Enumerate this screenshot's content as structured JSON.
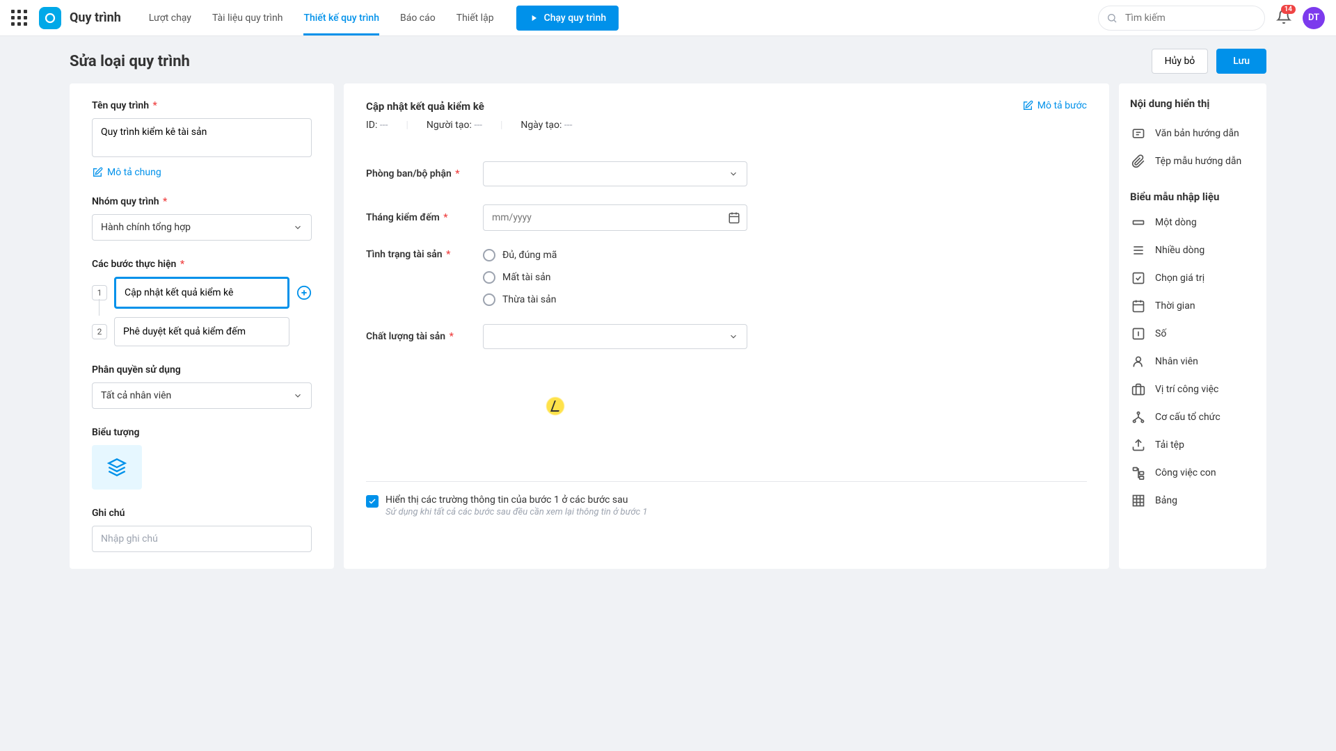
{
  "app": {
    "title": "Quy trình",
    "avatar": "DT",
    "notif_count": "14"
  },
  "nav": {
    "tabs": [
      "Lượt chạy",
      "Tài liệu quy trình",
      "Thiết kế quy trình",
      "Báo cáo",
      "Thiết lập"
    ],
    "active_index": 2,
    "run_label": "Chạy quy trình"
  },
  "search": {
    "placeholder": "Tìm kiếm"
  },
  "page": {
    "title": "Sửa loại quy trình",
    "cancel": "Hủy bỏ",
    "save": "Lưu"
  },
  "left": {
    "name_label": "Tên quy trình",
    "name_value": "Quy trình kiểm kê tài sản",
    "desc_link": "Mô tả chung",
    "group_label": "Nhóm quy trình",
    "group_value": "Hành chính tổng hợp",
    "steps_label": "Các bước thực hiện",
    "steps": [
      {
        "num": "1",
        "value": "Cập nhật kết quả kiểm kê",
        "active": true
      },
      {
        "num": "2",
        "value": "Phê duyệt kết quả kiểm đếm",
        "active": false
      }
    ],
    "perm_label": "Phân quyền sử dụng",
    "perm_value": "Tất cả nhân viên",
    "icon_label": "Biểu tượng",
    "notes_label": "Ghi chú",
    "notes_placeholder": "Nhập ghi chú"
  },
  "mid": {
    "title": "Cập nhật kết quả kiểm kê",
    "desc_link": "Mô tả bước",
    "meta": {
      "id_label": "ID:",
      "id_val": "---",
      "creator_label": "Người tạo:",
      "creator_val": "---",
      "date_label": "Ngày tạo:",
      "date_val": "---"
    },
    "fields": {
      "dept_label": "Phòng ban/bộ phận",
      "month_label": "Tháng kiểm đếm",
      "month_placeholder": "mm/yyyy",
      "status_label": "Tình trạng tài sản",
      "status_options": [
        "Đủ, đúng mã",
        "Mất tài sản",
        "Thừa tài sản"
      ],
      "quality_label": "Chất lượng tài sản"
    },
    "footer_check": "Hiển thị các trường thông tin của bước 1 ở các bước sau",
    "footer_hint": "Sử dụng khi tất cả các bước sau đều cần xem lại thông tin ở bước 1"
  },
  "right": {
    "content_title": "Nội dung hiển thị",
    "content_items": [
      "Văn bản hướng dẫn",
      "Tệp mẫu hướng dẫn"
    ],
    "form_title": "Biểu mẫu nhập liệu",
    "form_items": [
      "Một dòng",
      "Nhiều dòng",
      "Chọn giá trị",
      "Thời gian",
      "Số",
      "Nhân viên",
      "Vị trí công việc",
      "Cơ cấu tổ chức",
      "Tải tệp",
      "Công việc con",
      "Bảng"
    ]
  }
}
